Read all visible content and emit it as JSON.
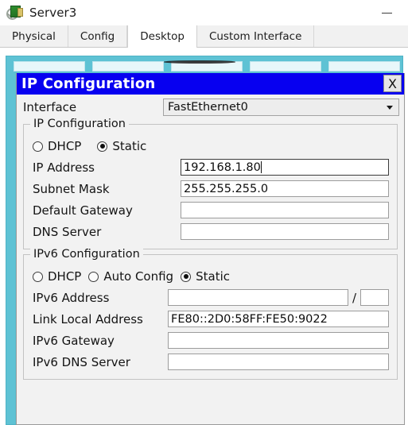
{
  "window": {
    "title": "Server3",
    "icon": "server-magnifier-icon",
    "minimize_label": "–"
  },
  "tabs": [
    {
      "label": "Physical",
      "active": false
    },
    {
      "label": "Config",
      "active": false
    },
    {
      "label": "Desktop",
      "active": true
    },
    {
      "label": "Custom Interface",
      "active": false
    }
  ],
  "dialog": {
    "title": "IP Configuration",
    "close_label": "X",
    "title_bg": "#0700f0",
    "title_fg": "#ffffff",
    "interface": {
      "label": "Interface",
      "value": "FastEthernet0",
      "options": [
        "FastEthernet0"
      ]
    },
    "ipv4": {
      "legend": "IP Configuration",
      "mode_options": [
        {
          "label": "DHCP",
          "selected": false
        },
        {
          "label": "Static",
          "selected": true
        }
      ],
      "fields": [
        {
          "label": "IP Address",
          "value": "192.168.1.80",
          "focused": true
        },
        {
          "label": "Subnet Mask",
          "value": "255.255.255.0",
          "focused": false
        },
        {
          "label": "Default Gateway",
          "value": "",
          "focused": false
        },
        {
          "label": "DNS Server",
          "value": "",
          "focused": false
        }
      ]
    },
    "ipv6": {
      "legend": "IPv6 Configuration",
      "mode_options": [
        {
          "label": "DHCP",
          "selected": false
        },
        {
          "label": "Auto Config",
          "selected": false
        },
        {
          "label": "Static",
          "selected": true
        }
      ],
      "address": {
        "label": "IPv6 Address",
        "value": "",
        "separator": "/",
        "prefix_value": ""
      },
      "fields": [
        {
          "label": "Link Local Address",
          "value": "FE80::2D0:58FF:FE50:9022",
          "focused": false
        },
        {
          "label": "IPv6 Gateway",
          "value": "",
          "focused": false
        },
        {
          "label": "IPv6 DNS Server",
          "value": "",
          "focused": false
        }
      ]
    }
  },
  "desktop_panel": {
    "accent_color": "#5ec2d4",
    "button_count": 5
  }
}
